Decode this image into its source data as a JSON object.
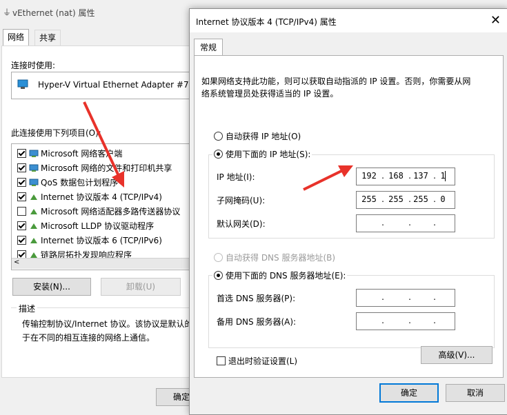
{
  "background_dialog": {
    "title": "vEthernet (nat) 属性",
    "tabs": [
      "网络",
      "共享"
    ],
    "connect_using_label": "连接时使用:",
    "adapter_name": "Hyper-V Virtual Ethernet Adapter #7",
    "items_label": "此连接使用下列项目(O):",
    "items": [
      {
        "label": "Microsoft 网络客户端",
        "checked": true,
        "icon": "network-icon"
      },
      {
        "label": "Microsoft 网络的文件和打印机共享",
        "checked": true,
        "icon": "network-icon"
      },
      {
        "label": "QoS 数据包计划程序",
        "checked": true,
        "icon": "network-icon"
      },
      {
        "label": "Internet 协议版本 4 (TCP/IPv4)",
        "checked": true,
        "icon": "protocol-icon"
      },
      {
        "label": "Microsoft 网络适配器多路传送器协议",
        "checked": false,
        "icon": "protocol-icon"
      },
      {
        "label": "Microsoft LLDP 协议驱动程序",
        "checked": true,
        "icon": "protocol-icon"
      },
      {
        "label": "Internet 协议版本 6 (TCP/IPv6)",
        "checked": true,
        "icon": "protocol-icon"
      },
      {
        "label": "链路层拓扑发现响应程序",
        "checked": true,
        "icon": "protocol-icon"
      }
    ],
    "install_button": "安装(N)...",
    "uninstall_button": "卸载(U)",
    "description_label": "描述",
    "description_text_1": "传输控制协议/Internet 协议。该协议是默认的",
    "description_text_2": "于在不同的相互连接的网络上通信。",
    "ok_button_partial": "确定"
  },
  "ipv4_dialog": {
    "title": "Internet 协议版本 4 (TCP/IPv4) 属性",
    "close_symbol": "✕",
    "tab": "常规",
    "intro_line_1": "如果网络支持此功能，则可以获取自动指派的 IP 设置。否则，你需要从网",
    "intro_line_2": "络系统管理员处获得适当的 IP 设置。",
    "auto_ip_label": "自动获得 IP 地址(O)",
    "manual_ip_label": "使用下面的 IP 地址(S):",
    "ip_address_label": "IP 地址(I):",
    "ip_address": [
      "192",
      "168",
      "137",
      "1"
    ],
    "subnet_mask_label": "子网掩码(U):",
    "subnet_mask": [
      "255",
      "255",
      "255",
      "0"
    ],
    "gateway_label": "默认网关(D):",
    "gateway": [
      "",
      "",
      "",
      ""
    ],
    "auto_dns_label": "自动获得 DNS 服务器地址(B)",
    "manual_dns_label": "使用下面的 DNS 服务器地址(E):",
    "preferred_dns_label": "首选 DNS 服务器(P):",
    "alternate_dns_label": "备用 DNS 服务器(A):",
    "validate_label": "退出时验证设置(L)",
    "advanced_button": "高级(V)...",
    "ok_button": "确定",
    "cancel_button": "取消"
  },
  "colors": {
    "annotation_arrow": "#e8322a",
    "accent": "#0078d7"
  }
}
